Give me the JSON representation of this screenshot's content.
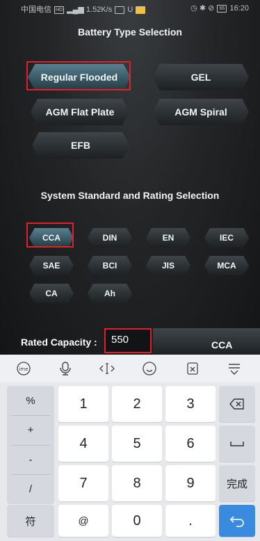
{
  "status_bar": {
    "carrier": "中国电信",
    "speed": "1.52K/s",
    "battery": "66",
    "time": "16:20"
  },
  "battery_type": {
    "heading": "Battery Type Selection",
    "options": [
      "Regular Flooded",
      "GEL",
      "AGM Flat Plate",
      "AGM Spiral",
      "EFB"
    ],
    "selected": "Regular Flooded"
  },
  "standard": {
    "heading": "System Standard and Rating Selection",
    "options": [
      "CCA",
      "DIN",
      "EN",
      "IEC",
      "SAE",
      "BCI",
      "JIS",
      "MCA",
      "CA",
      "Ah"
    ],
    "selected": "CCA"
  },
  "rated_capacity": {
    "label": "Rated Capacity :",
    "value": "550",
    "unit": "CCA"
  },
  "keyboard": {
    "symbols": [
      "%",
      "+",
      "-",
      "/"
    ],
    "digits": [
      "1",
      "2",
      "3",
      "4",
      "5",
      "6",
      "7",
      "8",
      "9",
      "0"
    ],
    "symbol_key": "符",
    "at_key": "@",
    "dot_key": ".",
    "done_key": "完成"
  },
  "colors": {
    "selection_outline": "#e0202a",
    "selected_button": "#4a6f7c",
    "enter_key": "#3a8be0"
  }
}
